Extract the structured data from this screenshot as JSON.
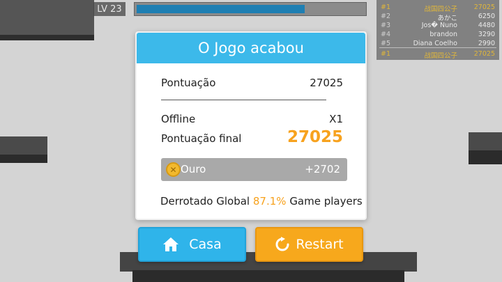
{
  "hud": {
    "level_label": "LV 23",
    "xp_progress": 0.74
  },
  "leaderboard": {
    "rows": [
      {
        "rank": "#1",
        "name": "战国四公子",
        "score": "27025"
      },
      {
        "rank": "#2",
        "name": "あかこ",
        "score": "6250"
      },
      {
        "rank": "#3",
        "name": "Jos� Nuno",
        "score": "4480"
      },
      {
        "rank": "#4",
        "name": "brandon",
        "score": "3290"
      },
      {
        "rank": "#5",
        "name": "Diana Coelho",
        "score": "2990"
      }
    ],
    "self": {
      "rank": "#1",
      "name": "战国四公子",
      "score": "27025"
    }
  },
  "dialog": {
    "title": "O Jogo acabou",
    "score_label": "Pontuação",
    "score_value": "27025",
    "offline_label": "Offline",
    "offline_value": "X1",
    "final_label": "Pontuação final",
    "final_value": "27025",
    "gold_label": "Ouro",
    "gold_value": "+2702",
    "defeat_prefix": "Derrotado Global",
    "defeat_pct": "87.1%",
    "defeat_suffix": "Game players"
  },
  "buttons": {
    "home_label": "Casa",
    "restart_label": "Restart"
  },
  "colors": {
    "header_blue": "#3cb9ea",
    "accent_orange": "#f7a21e",
    "home_button": "#2fb4ea",
    "restart_button": "#f7a81c"
  }
}
